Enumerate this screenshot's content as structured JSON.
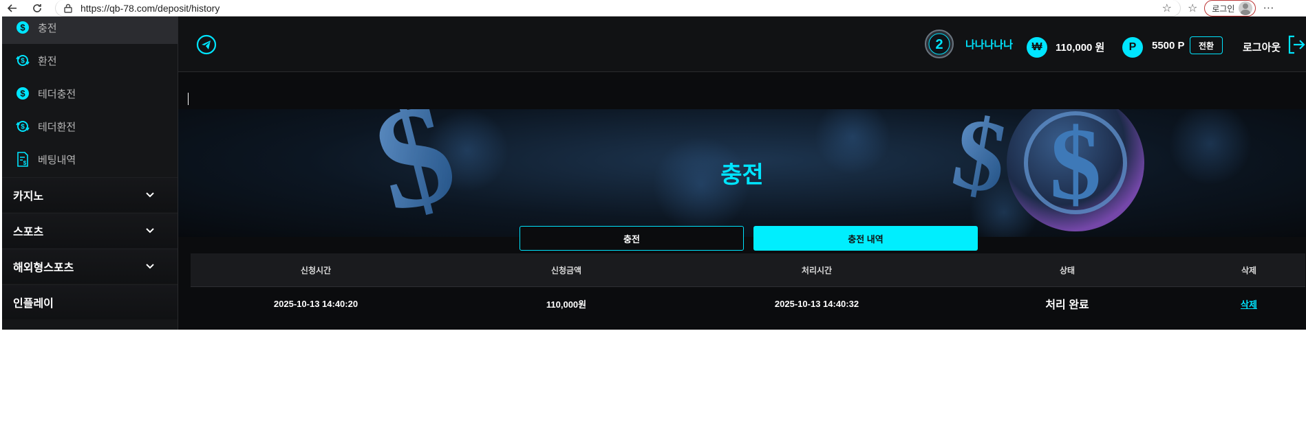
{
  "browser": {
    "url": "https://qb-78.com/deposit/history",
    "login_label": "로그인"
  },
  "sidebar": {
    "items": [
      {
        "label": "충전",
        "icon": "dollar-coin-icon"
      },
      {
        "label": "환전",
        "icon": "dollar-exchange-icon"
      },
      {
        "label": "테더충전",
        "icon": "dollar-coin-icon"
      },
      {
        "label": "테더환전",
        "icon": "dollar-exchange-icon"
      },
      {
        "label": "베팅내역",
        "icon": "receipt-icon"
      }
    ],
    "categories": [
      {
        "label": "카지노"
      },
      {
        "label": "스포츠"
      },
      {
        "label": "해외형스포츠"
      },
      {
        "label": "인플레이"
      }
    ]
  },
  "header": {
    "level": "2",
    "nickname": "나나나나나",
    "balance": "110,000 원",
    "currency_symbol": "₩",
    "points": "5500 P",
    "points_symbol": "P",
    "convert_label": "전환",
    "logout_label": "로그아웃"
  },
  "banner": {
    "title": "충전"
  },
  "tabs": {
    "deposit": "충전",
    "history": "충전 내역"
  },
  "table": {
    "headers": [
      "신청시간",
      "신청금액",
      "처리시간",
      "상태",
      "삭제"
    ],
    "rows": [
      [
        "2025-10-13 14:40:20",
        "110,000원",
        "2025-10-13 14:40:32",
        "처리 완료",
        "삭제"
      ]
    ]
  },
  "colors": {
    "accent": "#00e5ff",
    "background": "#0f1012",
    "sidebar": "#151618"
  }
}
